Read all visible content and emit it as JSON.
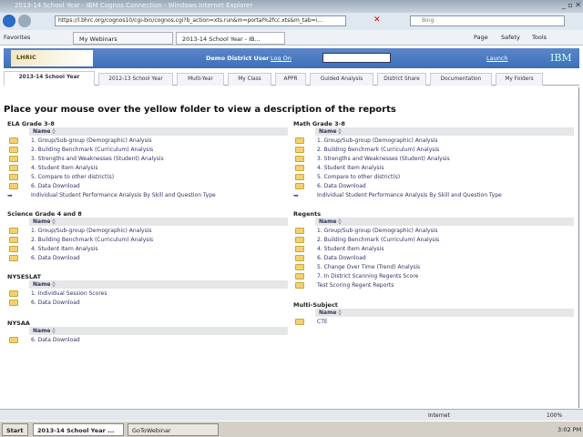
{
  "window": {
    "title": "2013-14 School Year - IBM Cognos Connection - Windows Internet Explorer"
  },
  "address": {
    "url": "https://l.bhrc.org/cognos10/cgi-bin/cognos.cgi?b_action=xts.run&m=portal%2fcc.xts&m_tab=i...",
    "search_placeholder": "Bing"
  },
  "favorites": {
    "label": "Favorites",
    "tabs": [
      "My Webinars",
      "2013-14 School Year - IB..."
    ],
    "tools": [
      "Page",
      "Safety",
      "Tools"
    ]
  },
  "cognos": {
    "logo": "LHRIC",
    "user": "Demo District User",
    "logon": "Log On",
    "launch": "Launch",
    "brand": "IBM"
  },
  "tabs": [
    "2013-14 School Year",
    "2012-13 School Year",
    "Multi-Year",
    "My Class",
    "APPR",
    "Guided Analysis",
    "District Share",
    "Documentation",
    "My Folders"
  ],
  "heading": "Place your mouse over the yellow folder to view a description of the reports",
  "name_header": "Name ◊",
  "left_sections": [
    {
      "title": "ELA Grade 3-8",
      "items": [
        "1. Group/Sub-group (Demographic) Analysis",
        "2. Building Benchmark (Curriculum) Analysis",
        "3. Strengths and Weaknesses (Student) Analysis",
        "4. Student Item Analysis",
        "5. Compare to other district(s)",
        "6. Data Download",
        "Individual Student Performance Analysis By Skill and Question Type"
      ]
    },
    {
      "title": "Science Grade 4 and 8",
      "items": [
        "1. Group/Sub-group (Demographic) Analysis",
        "2. Building Benchmark (Curriculum) Analysis",
        "4. Student Item Analysis",
        "6. Data Download"
      ]
    },
    {
      "title": "NYSESLAT",
      "items": [
        "1. Individual Session Scores",
        "6. Data Download"
      ]
    },
    {
      "title": "NYSAA",
      "items": [
        "6. Data Download"
      ]
    }
  ],
  "right_sections": [
    {
      "title": "Math Grade 3-8",
      "items": [
        "1. Group/Sub-group (Demographic) Analysis",
        "2. Building Benchmark (Curriculum) Analysis",
        "3. Strengths and Weaknesses (Student) Analysis",
        "4. Student Item Analysis",
        "5. Compare to other district(s)",
        "6. Data Download",
        "Individual Student Performance Analysis By Skill and Question Type"
      ]
    },
    {
      "title": "Regents",
      "items": [
        "1. Group/Sub-group (Demographic) Analysis",
        "2. Building Benchmark (Curriculum) Analysis",
        "4. Student Item Analysis",
        "6. Data Download",
        "5. Change Over Time (Trend) Analysis",
        "7. In District Scanning Regents Score",
        "Test Scoring Regent Reports"
      ]
    },
    {
      "title": "Multi-Subject",
      "items": [
        "CTE"
      ]
    }
  ],
  "status": {
    "zone": "Internet",
    "zoom": "100%"
  },
  "taskbar": {
    "start": "Start",
    "items": [
      "2013-14 School Year ...",
      "GoToWebinar"
    ],
    "clock": "3:02 PM"
  }
}
